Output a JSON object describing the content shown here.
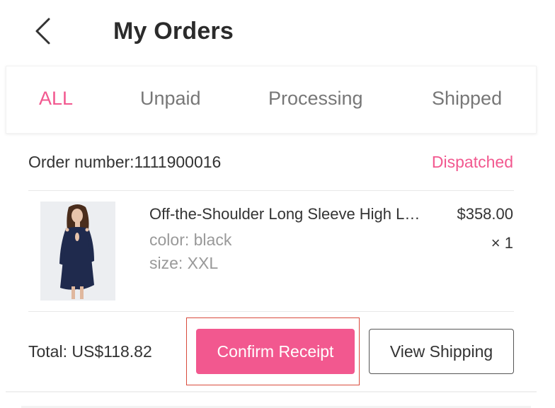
{
  "header": {
    "back_icon": "chevron-left-icon",
    "title": "My Orders"
  },
  "tabs": [
    {
      "label": "ALL",
      "active": true
    },
    {
      "label": "Unpaid",
      "active": false
    },
    {
      "label": "Processing",
      "active": false
    },
    {
      "label": "Shipped",
      "active": false
    }
  ],
  "colors": {
    "accent": "#f2588f",
    "highlight_border": "#d94b3d",
    "dress": "#1f2a4d"
  },
  "order": {
    "number_text": "Order number:1111900016",
    "status": "Dispatched",
    "item": {
      "name": "Off-the-Shoulder Long Sleeve High Low Dress",
      "color": "color: black",
      "size": "size: XXL",
      "price": "$358.00",
      "quantity": "× 1"
    },
    "total": "Total: US$118.82",
    "confirm_label": "Confirm Receipt",
    "view_shipping_label": "View Shipping"
  }
}
